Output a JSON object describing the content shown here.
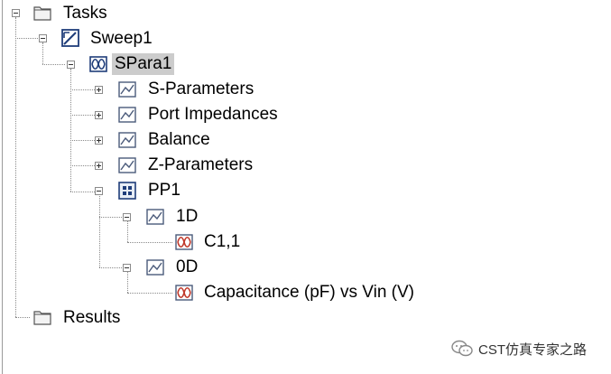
{
  "tree": {
    "root": {
      "label": "Tasks",
      "icon": "folder-icon"
    },
    "sweep": {
      "label": "Sweep1",
      "icon": "sweep-icon"
    },
    "spara": {
      "label": "SPara1",
      "icon": "spara-icon",
      "selected": true
    },
    "children": [
      {
        "label": "S-Parameters",
        "icon": "chart-icon",
        "expander": "plus"
      },
      {
        "label": "Port Impedances",
        "icon": "chart-icon",
        "expander": "plus"
      },
      {
        "label": "Balance",
        "icon": "chart-icon",
        "expander": "plus"
      },
      {
        "label": "Z-Parameters",
        "icon": "chart-icon",
        "expander": "plus"
      },
      {
        "label": "PP1",
        "icon": "postprocessing-icon",
        "expander": "minus"
      }
    ],
    "pp1_children": [
      {
        "label": "1D",
        "icon": "chart-icon",
        "leaf": {
          "label": "C1,1",
          "icon": "curve-result-icon"
        }
      },
      {
        "label": "0D",
        "icon": "chart-icon",
        "leaf": {
          "label": "Capacitance (pF) vs Vin (V)",
          "icon": "curve-result-icon"
        }
      }
    ],
    "results": {
      "label": "Results",
      "icon": "folder-icon"
    }
  },
  "watermark": {
    "text": "CST仿真专家之路",
    "icon": "wechat-icon"
  }
}
